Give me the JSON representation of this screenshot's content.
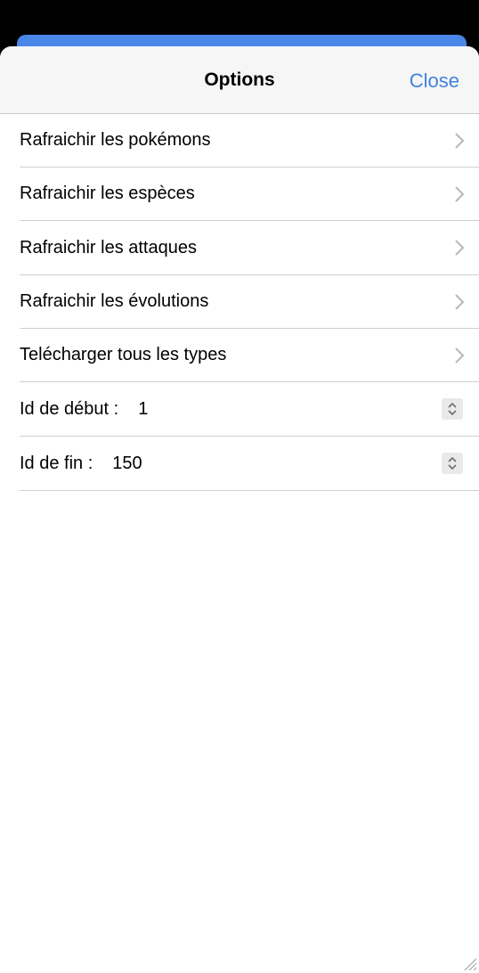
{
  "header": {
    "title": "Options",
    "close_label": "Close"
  },
  "menu": {
    "items": [
      {
        "label": "Rafraichir les pokémons"
      },
      {
        "label": "Rafraichir les espèces"
      },
      {
        "label": "Rafraichir les attaques"
      },
      {
        "label": "Rafraichir les évolutions"
      },
      {
        "label": "Telécharger tous les types"
      }
    ]
  },
  "fields": {
    "start_id": {
      "label": "Id de début :",
      "value": "1"
    },
    "end_id": {
      "label": "Id de fin :",
      "value": "150"
    }
  },
  "colors": {
    "accent": "#3f82e0",
    "backdrop_card": "#4a86e8"
  },
  "icons": {
    "row_chevron": "chevron-right-icon",
    "stepper": "up-down-stepper-icon",
    "resize": "resize-grip-icon"
  }
}
